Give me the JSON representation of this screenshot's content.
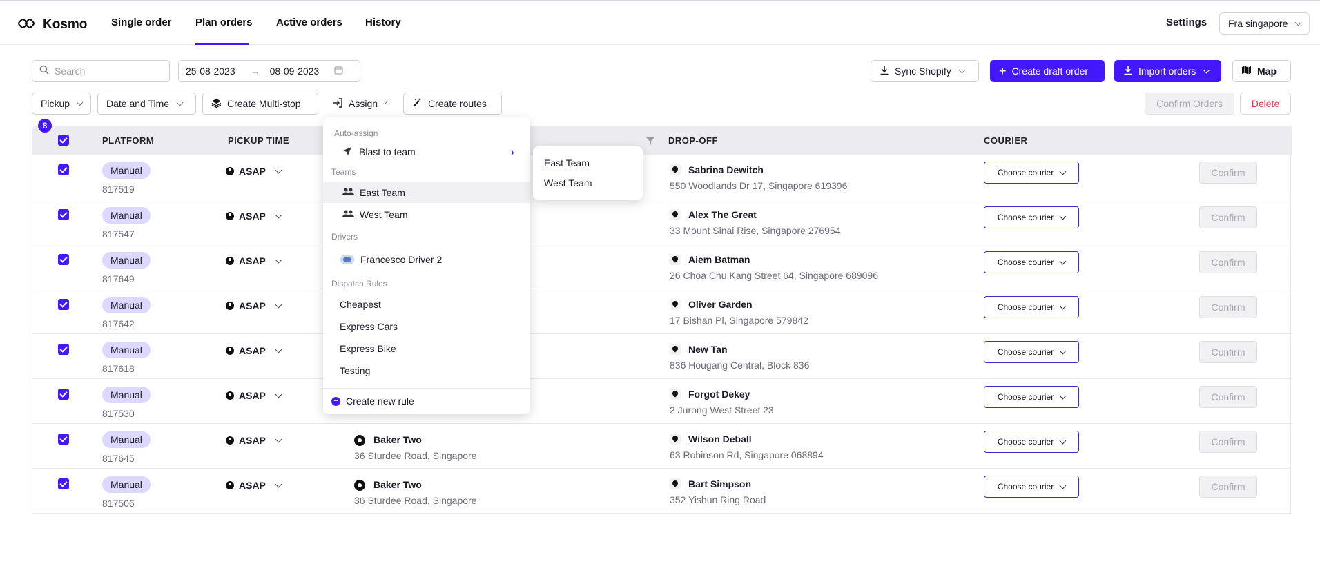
{
  "header": {
    "brand": "Kosmo",
    "nav": [
      {
        "label": "Single order"
      },
      {
        "label": "Plan orders"
      },
      {
        "label": "Active orders"
      },
      {
        "label": "History"
      }
    ],
    "settings_label": "Settings",
    "region": "Fra singapore"
  },
  "toolbar": {
    "search_placeholder": "Search",
    "date_from": "25-08-2023",
    "date_to": "08-09-2023",
    "sync_label": "Sync Shopify",
    "create_draft_label": "Create draft order",
    "import_label": "Import orders",
    "map_label": "Map",
    "pickup_filter": "Pickup",
    "datetime_filter": "Date and Time",
    "multistop_label": "Create Multi-stop",
    "assign_label": "Assign",
    "routes_label": "Create routes",
    "confirm_orders_label": "Confirm Orders",
    "delete_label": "Delete"
  },
  "table": {
    "selected_count": "8",
    "columns": {
      "platform": "PLATFORM",
      "pickup_time": "PICKUP TIME",
      "dropoff": "DROP-OFF",
      "courier": "COURIER"
    },
    "rows": [
      {
        "platform": "Manual",
        "id": "817519",
        "time": "ASAP",
        "pickup_name": "",
        "pickup_addr": "",
        "dropoff_name": "Sabrina Dewitch",
        "dropoff_addr": "550 Woodlands Dr 17, Singapore 619396",
        "courier": "Choose courier",
        "confirm": "Confirm"
      },
      {
        "platform": "Manual",
        "id": "817547",
        "time": "ASAP",
        "pickup_name": "",
        "pickup_addr": "",
        "dropoff_name": "Alex The Great",
        "dropoff_addr": "33 Mount Sinai Rise, Singapore 276954",
        "courier": "Choose courier",
        "confirm": "Confirm"
      },
      {
        "platform": "Manual",
        "id": "817649",
        "time": "ASAP",
        "pickup_name": "",
        "pickup_addr": "",
        "dropoff_name": "Aiem Batman",
        "dropoff_addr": "26 Choa Chu Kang Street 64, Singapore 689096",
        "courier": "Choose courier",
        "confirm": "Confirm"
      },
      {
        "platform": "Manual",
        "id": "817642",
        "time": "ASAP",
        "pickup_name": "",
        "pickup_addr": "",
        "dropoff_name": "Oliver Garden",
        "dropoff_addr": "17 Bishan Pl, Singapore 579842",
        "courier": "Choose courier",
        "confirm": "Confirm"
      },
      {
        "platform": "Manual",
        "id": "817618",
        "time": "ASAP",
        "pickup_name": "",
        "pickup_addr": "",
        "dropoff_name": "New Tan",
        "dropoff_addr": "836 Hougang Central, Block 836",
        "courier": "Choose courier",
        "confirm": "Confirm"
      },
      {
        "platform": "Manual",
        "id": "817530",
        "time": "ASAP",
        "pickup_name": "",
        "pickup_addr": "",
        "dropoff_name": "Forgot Dekey",
        "dropoff_addr": "2 Jurong West Street 23",
        "courier": "Choose courier",
        "confirm": "Confirm"
      },
      {
        "platform": "Manual",
        "id": "817645",
        "time": "ASAP",
        "pickup_name": "Baker Two",
        "pickup_addr": "36 Sturdee Road, Singapore",
        "dropoff_name": "Wilson Deball",
        "dropoff_addr": "63 Robinson Rd, Singapore 068894",
        "courier": "Choose courier",
        "confirm": "Confirm"
      },
      {
        "platform": "Manual",
        "id": "817506",
        "time": "ASAP",
        "pickup_name": "Baker Two",
        "pickup_addr": "36 Sturdee Road, Singapore",
        "dropoff_name": "Bart Simpson",
        "dropoff_addr": "352 Yishun Ring Road",
        "courier": "Choose courier",
        "confirm": "Confirm"
      }
    ]
  },
  "assign_menu": {
    "auto_assign_label": "Auto-assign",
    "blast_label": "Blast to team",
    "teams_label": "Teams",
    "teams": [
      "East Team",
      "West Team"
    ],
    "drivers_label": "Drivers",
    "driver": "Francesco Driver 2",
    "rules_label": "Dispatch Rules",
    "rules": [
      "Cheapest",
      "Express Cars",
      "Express Bike",
      "Testing"
    ],
    "create_rule": "Create new rule"
  },
  "blast_submenu": [
    "East Team",
    "West Team"
  ],
  "colors": {
    "accent": "#4318ff",
    "danger": "#e0364d"
  }
}
